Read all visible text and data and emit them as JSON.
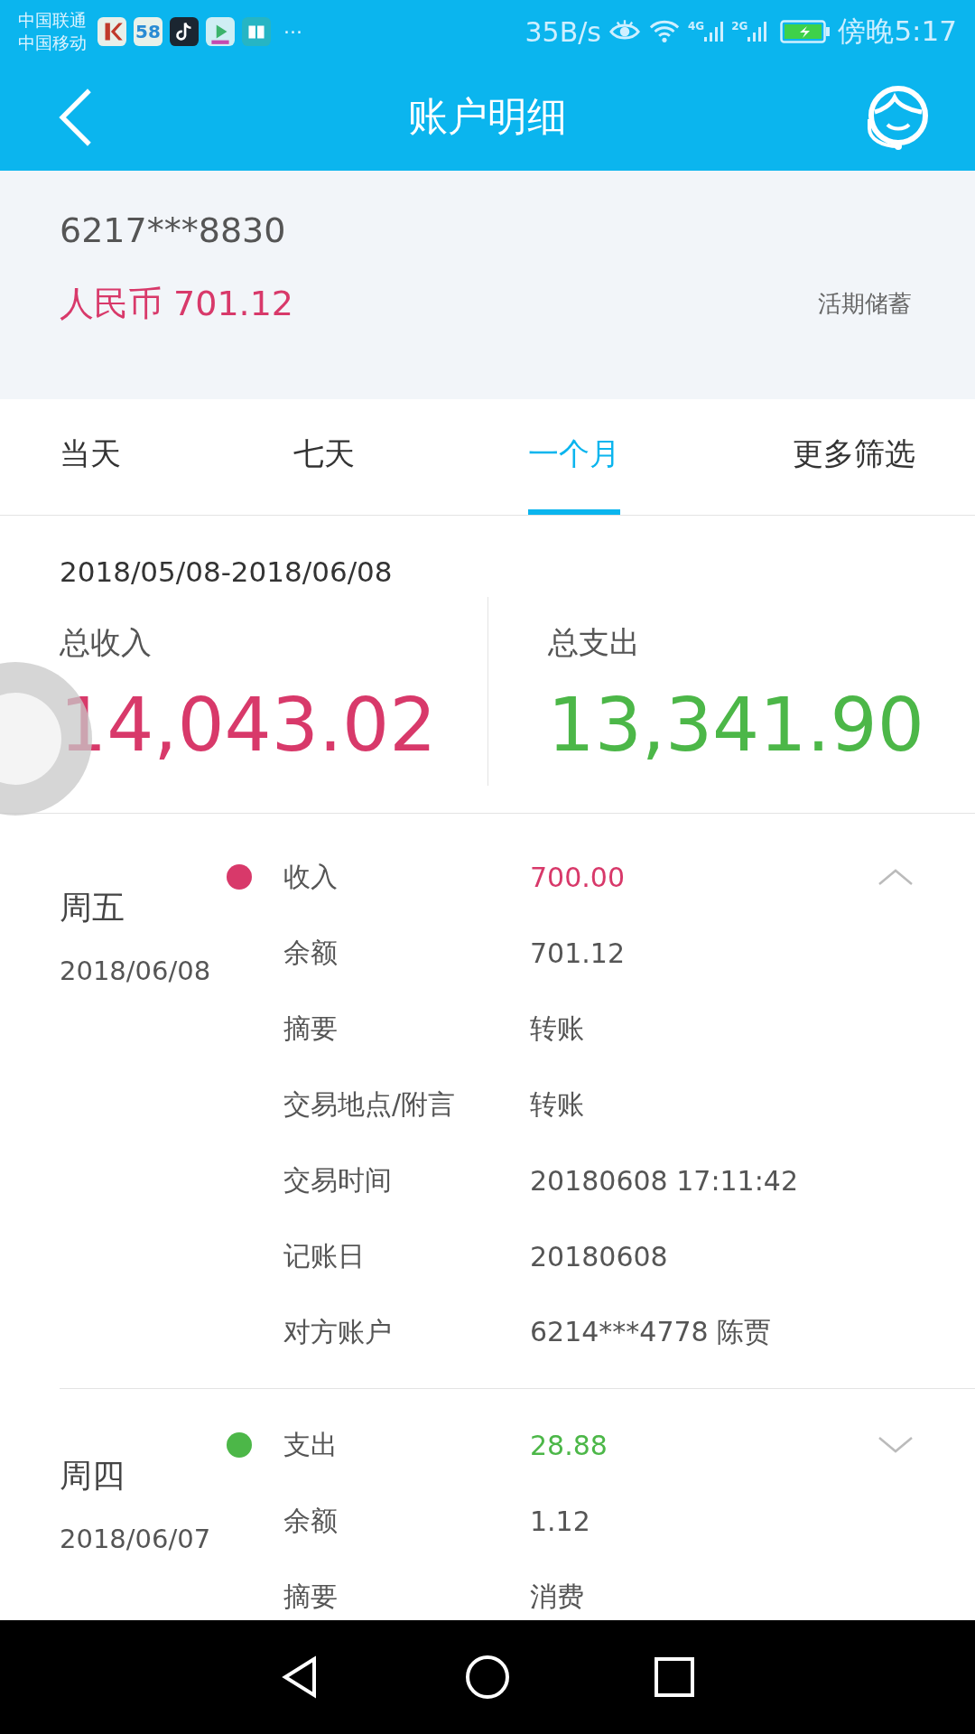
{
  "status_bar": {
    "carriers": [
      "中国联通",
      "中国移动"
    ],
    "app_icons": [
      {
        "kind": "poster"
      },
      {
        "kind": "text",
        "text": "58"
      },
      {
        "kind": "note"
      },
      {
        "kind": "video"
      },
      {
        "kind": "book"
      }
    ],
    "more": "···",
    "speed": "35B/s",
    "signals": [
      {
        "label": "4G"
      },
      {
        "label": "2G"
      }
    ],
    "time": "傍晚5:17"
  },
  "header": {
    "title": "账户明细"
  },
  "account": {
    "number": "6217***8830",
    "balance": "人民币 701.12",
    "type": "活期储蓄"
  },
  "tabs": [
    {
      "label": "当天",
      "selected": false
    },
    {
      "label": "七天",
      "selected": false
    },
    {
      "label": "一个月",
      "selected": true
    },
    {
      "label": "更多筛选",
      "selected": false
    }
  ],
  "period": "2018/05/08-2018/06/08",
  "totals": [
    {
      "kind": "income",
      "label": "总收入",
      "amount": "14,043.02"
    },
    {
      "kind": "expense",
      "label": "总支出",
      "amount": "13,341.90"
    }
  ],
  "transactions": [
    {
      "day": "周五",
      "date": "2018/06/08",
      "kind": "income",
      "expanded": true,
      "type": "收入",
      "amount": "700.00",
      "details": [
        {
          "label": "余额",
          "value": "701.12"
        },
        {
          "label": "摘要",
          "value": "转账"
        },
        {
          "label": "交易地点/附言",
          "value": "转账"
        },
        {
          "label": "交易时间",
          "value": "20180608 17:11:42"
        },
        {
          "label": "记账日",
          "value": "20180608"
        },
        {
          "label": "对方账户",
          "value": "6214***4778 陈贾"
        }
      ]
    },
    {
      "day": "周四",
      "date": "2018/06/07",
      "kind": "expense",
      "expanded": false,
      "type": "支出",
      "amount": "28.88",
      "details": [
        {
          "label": "余额",
          "value": "1.12"
        },
        {
          "label": "摘要",
          "value": "消费"
        }
      ]
    }
  ]
}
